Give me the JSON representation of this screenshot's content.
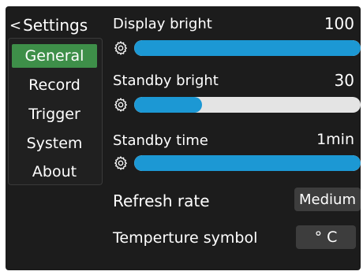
{
  "sidebar": {
    "back_label": "Settings",
    "items": [
      {
        "label": "General",
        "active": true
      },
      {
        "label": "Record"
      },
      {
        "label": "Trigger"
      },
      {
        "label": "System"
      },
      {
        "label": "About"
      }
    ]
  },
  "settings": {
    "display_bright": {
      "label": "Display bright",
      "value": "100",
      "level": 1.0
    },
    "standby_bright": {
      "label": "Standby bright",
      "value": "30",
      "level": 0.3
    },
    "standby_time": {
      "label": "Standby time",
      "value": "1min",
      "level": 1.0
    },
    "refresh_rate": {
      "label": "Refresh rate",
      "value": "Medium"
    },
    "temperature_symbol": {
      "label": "Temperture symbol",
      "value": "° C"
    }
  },
  "colors": {
    "accent_green": "#3e8f49",
    "slider_blue": "#1c98d4",
    "track_gray": "#e4e4e4",
    "background": "#1c1c1c"
  },
  "icons": {
    "back": "chevron-left-icon",
    "slider": "gear-icon"
  }
}
